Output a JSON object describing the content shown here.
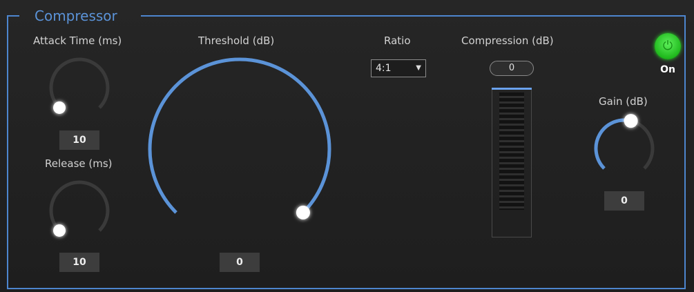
{
  "panel": {
    "title": "Compressor"
  },
  "attack": {
    "label": "Attack Time (ms)",
    "value": "10",
    "level": 0.0
  },
  "release": {
    "label": "Release (ms)",
    "value": "10",
    "level": 0.0
  },
  "threshold": {
    "label": "Threshold (dB)",
    "value": "0",
    "level": 1.0
  },
  "ratio": {
    "label": "Ratio",
    "selected": "4:1"
  },
  "compression": {
    "label": "Compression (dB)",
    "value": "0",
    "meter_level": 0.0
  },
  "gain": {
    "label": "Gain (dB)",
    "value": "0",
    "level": 0.55
  },
  "power": {
    "label": "On",
    "icon": "power-icon",
    "state": "on"
  },
  "colors": {
    "accent": "#5b93d8",
    "power_on": "#3fd43b",
    "knob_track": "#3a3a3a"
  }
}
